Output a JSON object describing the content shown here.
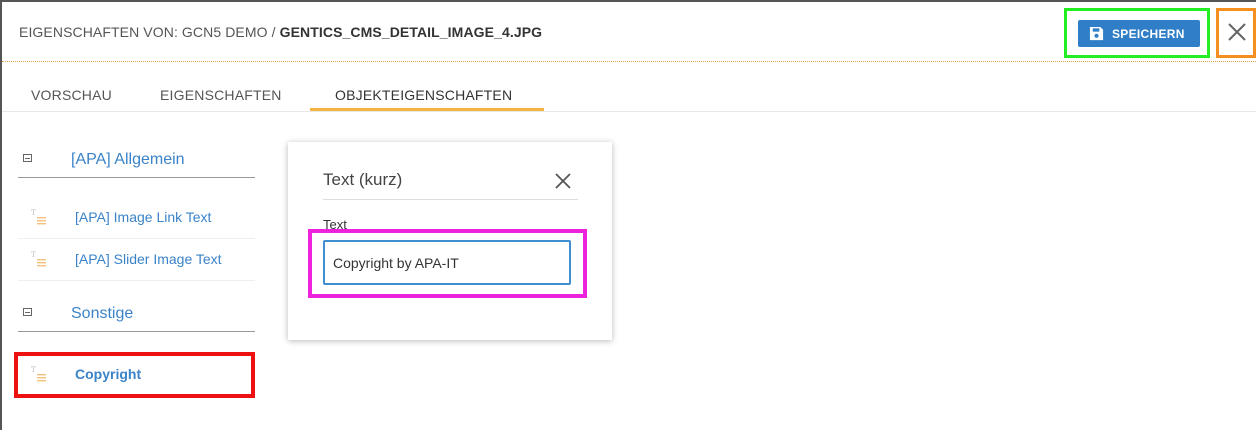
{
  "header": {
    "title_prefix": "EIGENSCHAFTEN VON: GCN5 DEMO / ",
    "title_name": "GENTICS_CMS_DETAIL_IMAGE_4.JPG",
    "save_label": "SPEICHERN",
    "save_icon": "floppy-disk-icon",
    "close_icon": "close-icon"
  },
  "tabs": [
    {
      "label": "VORSCHAU"
    },
    {
      "label": "EIGENSCHAFTEN"
    },
    {
      "label": "OBJEKTEIGENSCHAFTEN",
      "active": true
    }
  ],
  "sidebar": {
    "groups": [
      {
        "label": "[APA] Allgemein",
        "icon": "collapse-minus-icon",
        "items": [
          {
            "label": "[APA] Image Link Text",
            "icon": "text-property-icon"
          },
          {
            "label": "[APA] Slider Image Text",
            "icon": "text-property-icon"
          }
        ]
      },
      {
        "label": "Sonstige",
        "icon": "collapse-minus-icon",
        "items": [
          {
            "label": "Copyright",
            "icon": "text-property-icon",
            "selected": true
          }
        ]
      }
    ]
  },
  "editor": {
    "title": "Text (kurz)",
    "close_icon": "close-icon",
    "field_label": "Text",
    "field_value": "Copyright by APA-IT"
  },
  "colors": {
    "accent_blue": "#2f7ec7",
    "link_blue": "#3a83c9",
    "tab_underline": "#f5b342",
    "highlight_green": "#22ee22",
    "highlight_orange": "#f5901e",
    "highlight_red": "#ee1111",
    "highlight_magenta": "#ee22dd"
  }
}
